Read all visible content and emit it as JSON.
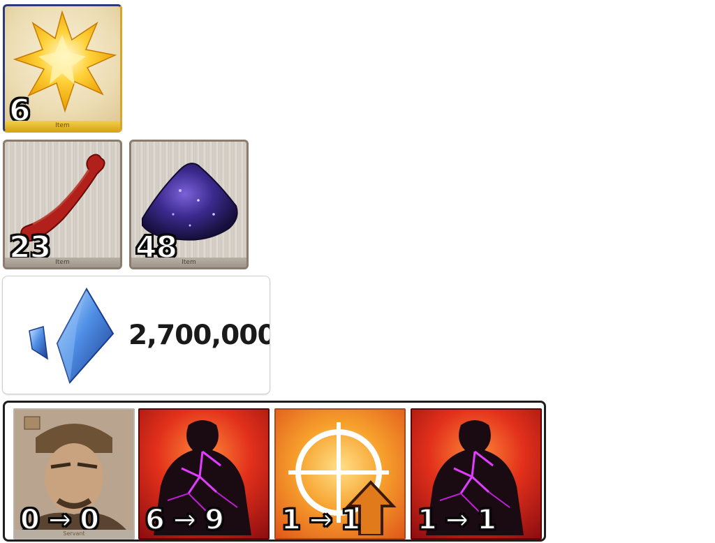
{
  "items": [
    {
      "name": "golden-star-item",
      "count": "6",
      "tag": "Item"
    },
    {
      "name": "red-bone-item",
      "count": "23",
      "tag": "Item"
    },
    {
      "name": "purple-dust-item",
      "count": "48",
      "tag": "Item"
    }
  ],
  "qp": {
    "value": "2,700,000"
  },
  "skills": {
    "portrait": {
      "change": "0 → 0",
      "tag": "Servant"
    },
    "buff_1": {
      "change": "6 → 9"
    },
    "target": {
      "change": "1 → 1"
    },
    "buff_2": {
      "change": "1 → 1"
    }
  },
  "colors": {
    "gold_frame": "#d6a624",
    "wood_frame": "#8a7c6f",
    "qp_crystal": "#3f7fd6",
    "buff_red": "#e2301b",
    "target_orange": "#f7a12d",
    "panel_border": "#1e1e1e"
  }
}
